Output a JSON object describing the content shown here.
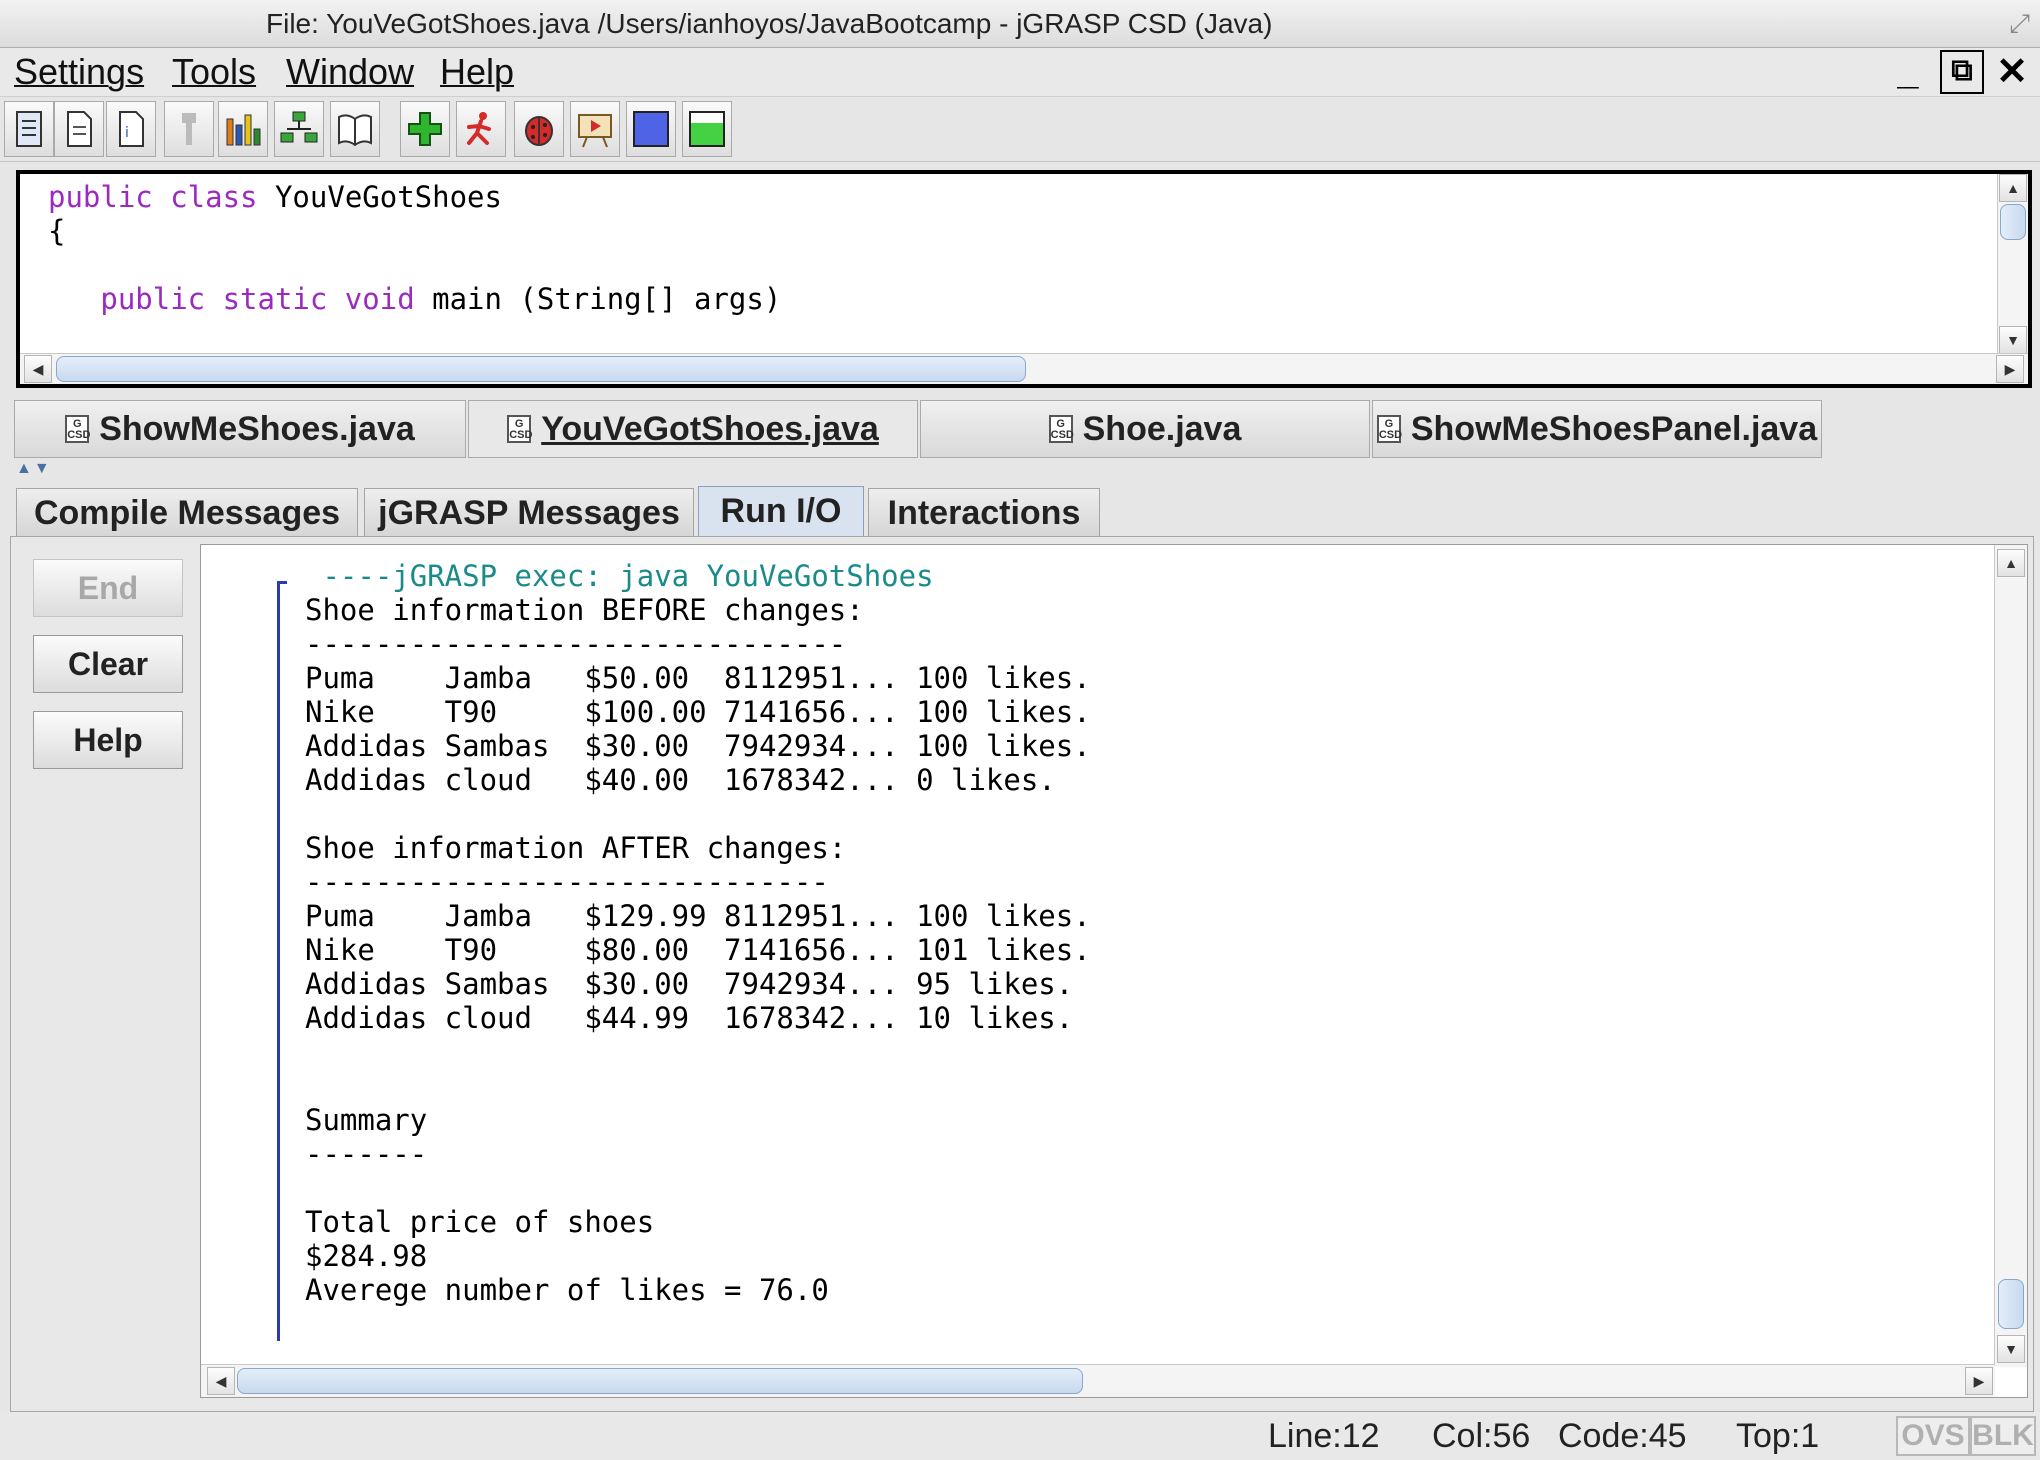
{
  "window": {
    "title": "File: YouVeGotShoes.java  /Users/ianhoyos/JavaBootcamp - jGRASP CSD (Java)"
  },
  "menu": {
    "items": [
      "Settings",
      "Tools",
      "Window",
      "Help"
    ]
  },
  "window_controls": {
    "minimize": "_",
    "restore": "⧉",
    "close": "✕"
  },
  "toolbar": {
    "icons": [
      "browse-icon",
      "new-file-icon",
      "open-file-icon",
      "pin-icon",
      "bar-chart-icon",
      "uml-diagram-icon",
      "book-icon",
      "compile-icon",
      "run-icon",
      "debug-icon",
      "run-applet-icon",
      "blue-square-icon",
      "green-window-icon"
    ]
  },
  "editor": {
    "lines": [
      {
        "kw": "public class",
        "rest": " YouVeGotShoes"
      },
      {
        "kw": "",
        "rest": "{"
      },
      {
        "kw": "",
        "rest": ""
      },
      {
        "kw": "   public static void",
        "rest": " main (String[] args)"
      }
    ]
  },
  "file_tabs": [
    {
      "label": "ShowMeShoes.java",
      "active": false
    },
    {
      "label": "YouVeGotShoes.java",
      "active": true
    },
    {
      "label": "Shoe.java",
      "active": false
    },
    {
      "label": "ShowMeShoesPanel.java",
      "active": false
    }
  ],
  "message_tabs": [
    {
      "label": "Compile Messages",
      "active": false
    },
    {
      "label": "jGRASP Messages",
      "active": false
    },
    {
      "label": "Run I/O",
      "active": true
    },
    {
      "label": "Interactions",
      "active": false
    }
  ],
  "side_buttons": {
    "end": "End",
    "clear": "Clear",
    "help": "Help"
  },
  "output": {
    "exec_line": " ----jGRASP exec: java YouVeGotShoes",
    "lines": [
      "Shoe information BEFORE changes:",
      "-------------------------------",
      "Puma    Jamba   $50.00  8112951... 100 likes.",
      "Nike    T90     $100.00 7141656... 100 likes.",
      "Addidas Sambas  $30.00  7942934... 100 likes.",
      "Addidas cloud   $40.00  1678342... 0 likes.",
      "",
      "Shoe information AFTER changes:",
      "------------------------------",
      "Puma    Jamba   $129.99 8112951... 100 likes.",
      "Nike    T90     $80.00  7141656... 101 likes.",
      "Addidas Sambas  $30.00  7942934... 95 likes.",
      "Addidas cloud   $44.99  1678342... 10 likes.",
      "",
      "",
      "Summary",
      "-------",
      "",
      "Total price of shoes",
      "$284.98",
      "Averege number of likes = 76.0"
    ]
  },
  "status": {
    "line": "Line:12",
    "col": "Col:56",
    "code": "Code:45",
    "top": "Top:1",
    "ovs": "OVS",
    "blk": "BLK"
  }
}
